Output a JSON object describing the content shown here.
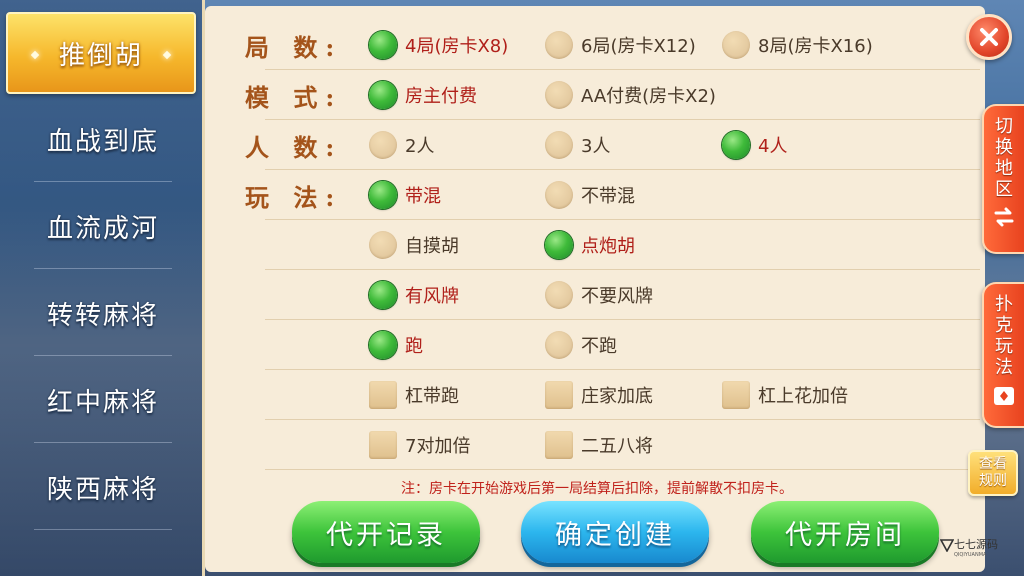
{
  "sidebar": {
    "items": [
      {
        "label": "推倒胡",
        "active": true
      },
      {
        "label": "血战到底",
        "active": false
      },
      {
        "label": "血流成河",
        "active": false
      },
      {
        "label": "转转麻将",
        "active": false
      },
      {
        "label": "红中麻将",
        "active": false
      },
      {
        "label": "陕西麻将",
        "active": false
      }
    ]
  },
  "rounds": {
    "label": "局 数:",
    "options": [
      {
        "label": "4局(房卡X8)",
        "selected": true
      },
      {
        "label": "6局(房卡X12)",
        "selected": false
      },
      {
        "label": "8局(房卡X16)",
        "selected": false
      }
    ]
  },
  "mode": {
    "label": "模 式:",
    "options": [
      {
        "label": "房主付费",
        "selected": true
      },
      {
        "label": "AA付费(房卡X2)",
        "selected": false
      }
    ]
  },
  "players": {
    "label": "人 数:",
    "options": [
      {
        "label": "2人",
        "selected": false
      },
      {
        "label": "3人",
        "selected": false
      },
      {
        "label": "4人",
        "selected": true
      }
    ]
  },
  "rules": {
    "label": "玩 法:",
    "radio_rows": [
      [
        {
          "label": "带混",
          "selected": true
        },
        {
          "label": "不带混",
          "selected": false
        }
      ],
      [
        {
          "label": "自摸胡",
          "selected": false
        },
        {
          "label": "点炮胡",
          "selected": true
        }
      ],
      [
        {
          "label": "有风牌",
          "selected": true
        },
        {
          "label": "不要风牌",
          "selected": false
        }
      ],
      [
        {
          "label": "跑",
          "selected": true
        },
        {
          "label": "不跑",
          "selected": false
        }
      ]
    ],
    "check_rows": [
      [
        {
          "label": "杠带跑",
          "checked": false
        },
        {
          "label": "庄家加底",
          "checked": false
        },
        {
          "label": "杠上花加倍",
          "checked": false
        }
      ],
      [
        {
          "label": "7对加倍",
          "checked": false
        },
        {
          "label": "二五八将",
          "checked": false
        }
      ]
    ]
  },
  "notice": "注：房卡在开始游戏后第一局结算后扣除，提前解散不扣房卡。",
  "buttons": {
    "records": "代开记录",
    "confirm": "确定创建",
    "proxy_room": "代开房间"
  },
  "right_tabs": {
    "switch_region": "切换地区",
    "poker_rules": "扑克玩法"
  },
  "view_rules": {
    "line1": "查看",
    "line2": "规则"
  },
  "watermark": {
    "title": "七七源码",
    "sub": "QIQIYUANMA"
  },
  "colors": {
    "selected_text": "#b0201a",
    "label": "#a4541b",
    "panel_bg": "#f7ecd9",
    "accent_green": "#3ec43b",
    "accent_blue": "#2cb6ee",
    "tab_orange": "#e8431f"
  }
}
